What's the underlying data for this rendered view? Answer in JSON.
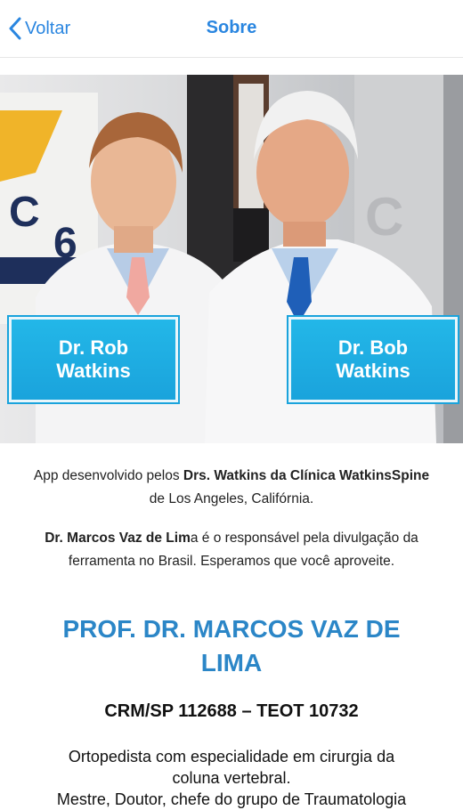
{
  "navbar": {
    "back_label": "Voltar",
    "title": "Sobre",
    "accent_color": "#2a86e0"
  },
  "hero": {
    "badges": [
      {
        "line1": "Dr. Rob",
        "line2": "Watkins"
      },
      {
        "line1": "Dr. Bob",
        "line2": "Watkins"
      }
    ],
    "badge_color": "#1aa3dc"
  },
  "intro": {
    "p1_text1": "App desenvolvido pelos ",
    "p1_bold": "Drs. Watkins da Clínica WatkinsSpine",
    "p1_text2": "de Los Angeles, Califórnia.",
    "p2_bold": "Dr. Marcos Vaz de Lim",
    "p2_text1": "a é o responsável pela divulgação da",
    "p2_text2": "ferramenta no Brasil. Esperamos que você aproveite."
  },
  "profile": {
    "heading": "PROF. DR. MARCOS VAZ DE LIMA",
    "crm": "CRM/SP 112688 – TEOT 10732",
    "specialty_line1": "Ortopedista com especialidade em cirurgia da",
    "specialty_line2": "coluna vertebral.",
    "specialty_line3": "Mestre, Doutor, chefe do grupo de Traumatologia"
  }
}
